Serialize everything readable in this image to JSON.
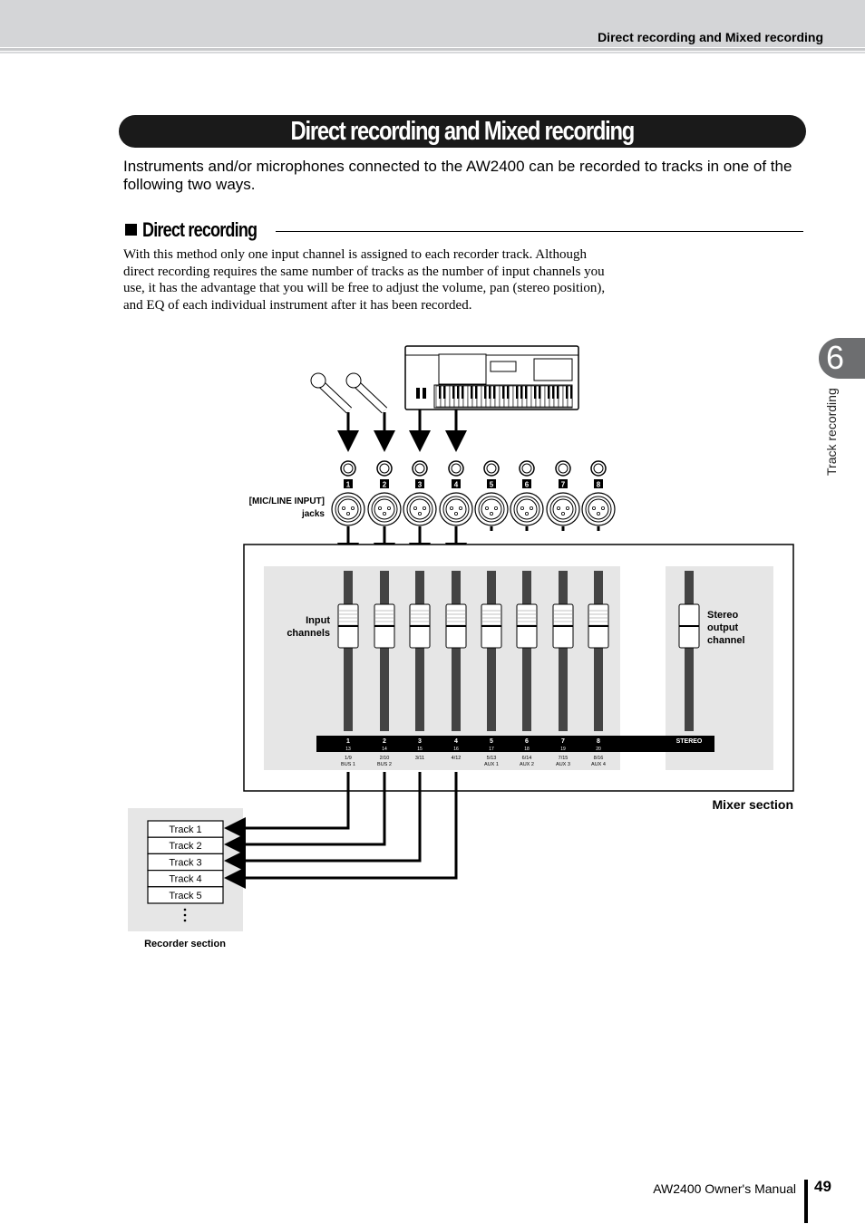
{
  "header": {
    "running_title": "Direct recording and Mixed recording"
  },
  "title": "Direct recording and Mixed recording",
  "intro": "Instruments and/or microphones connected to the AW2400 can be recorded to tracks in one of the following two ways.",
  "section": {
    "heading": "Direct recording",
    "body": "With this method only one input channel is assigned to each recorder track. Although direct recording requires the same number of tracks as the number of input channels you use, it has the advantage that you will be free to adjust the volume, pan (stereo position), and EQ of each individual instrument after it has been recorded."
  },
  "chapter_tab": {
    "number": "6",
    "label": "Track recording"
  },
  "diagram": {
    "jacks_label": [
      "[MIC/LINE INPUT]",
      "jacks"
    ],
    "jack_numbers": [
      "1",
      "2",
      "3",
      "4",
      "5",
      "6",
      "7",
      "8"
    ],
    "input_channels_label": [
      "Input",
      "channels"
    ],
    "stereo_label": [
      "Stereo",
      "output",
      "channel"
    ],
    "channels": [
      {
        "num": "1",
        "sub": "13",
        "bus": "1/9",
        "bus2": "BUS 1"
      },
      {
        "num": "2",
        "sub": "14",
        "bus": "2/10",
        "bus2": "BUS 2"
      },
      {
        "num": "3",
        "sub": "15",
        "bus": "3/11",
        "bus2": ""
      },
      {
        "num": "4",
        "sub": "16",
        "bus": "4/12",
        "bus2": ""
      },
      {
        "num": "5",
        "sub": "17",
        "bus": "5/13",
        "bus2": "AUX 1"
      },
      {
        "num": "6",
        "sub": "18",
        "bus": "6/14",
        "bus2": "AUX 2"
      },
      {
        "num": "7",
        "sub": "19",
        "bus": "7/15",
        "bus2": "AUX 3"
      },
      {
        "num": "8",
        "sub": "20",
        "bus": "8/16",
        "bus2": "AUX 4"
      }
    ],
    "stereo": "STEREO",
    "mixer_label": "Mixer section",
    "tracks": [
      "Track 1",
      "Track 2",
      "Track 3",
      "Track 4",
      "Track 5"
    ],
    "recorder_label": "Recorder section"
  },
  "footer": {
    "manual": "AW2400  Owner's Manual",
    "page": "49"
  }
}
